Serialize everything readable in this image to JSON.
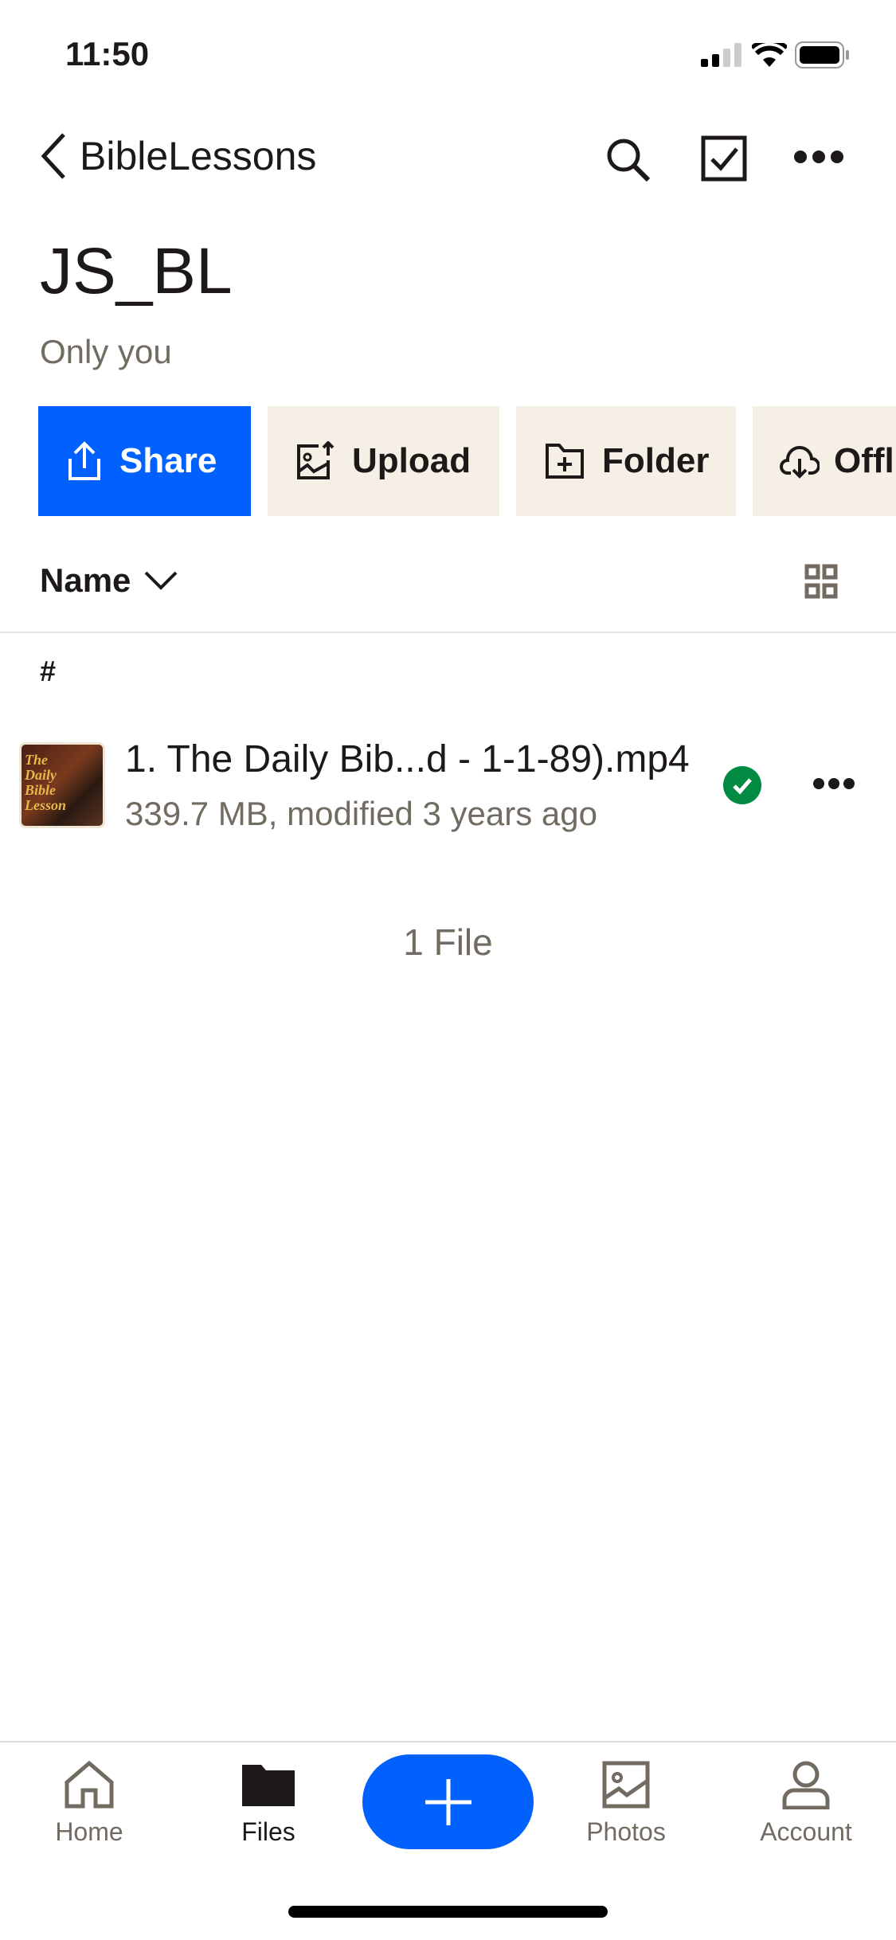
{
  "status_bar": {
    "time": "11:50"
  },
  "nav": {
    "back_label": "BibleLessons"
  },
  "folder": {
    "title": "JS_BL",
    "sharing": "Only you"
  },
  "actions": [
    {
      "label": "Share",
      "icon": "share-icon"
    },
    {
      "label": "Upload",
      "icon": "upload-photo-icon"
    },
    {
      "label": "Folder",
      "icon": "new-folder-icon"
    },
    {
      "label": "Offl",
      "icon": "cloud-download-icon"
    }
  ],
  "list": {
    "sort_label": "Name",
    "section": "#",
    "files": [
      {
        "name": "1. The Daily Bib...d - 1-1-89).mp4",
        "meta": "339.7 MB, modified 3 years ago",
        "thumb_text": "The Daily Bible Lesson",
        "synced": true
      }
    ],
    "count": "1 File"
  },
  "tabs": [
    {
      "label": "Home"
    },
    {
      "label": "Files"
    },
    {
      "label": "Photos"
    },
    {
      "label": "Account"
    }
  ],
  "colors": {
    "accent": "#0061fe",
    "synced": "#008a42",
    "button_bg": "#f5efe6",
    "secondary_text": "#716b61"
  }
}
